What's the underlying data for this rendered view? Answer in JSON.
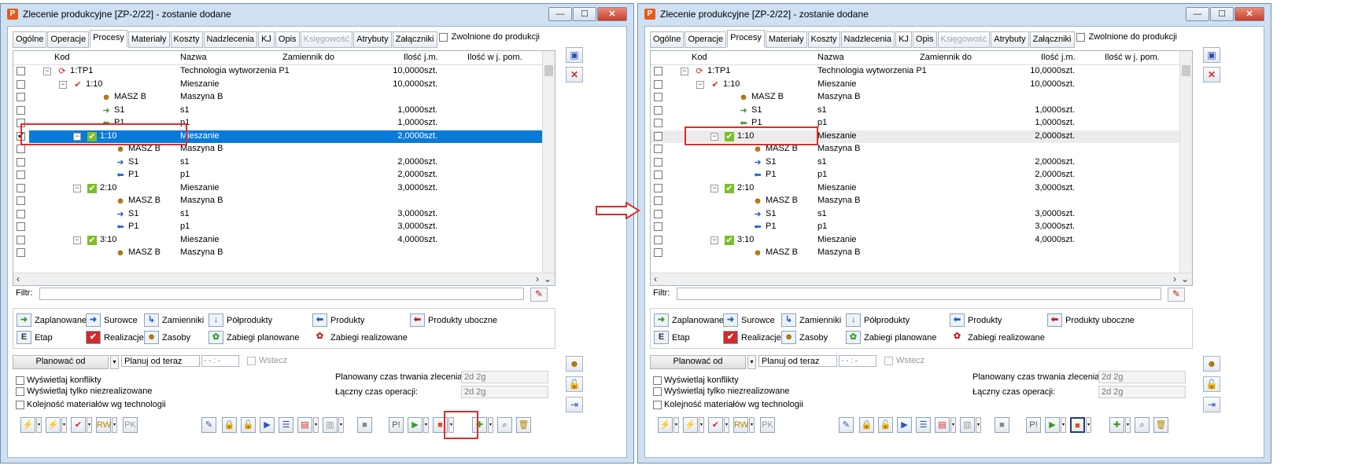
{
  "window": {
    "title": "Zlecenie produkcyjne  [ZP-2/22] - zostanie dodane",
    "app_icon": "P"
  },
  "tabs": [
    "Ogólne",
    "Operacje",
    "Procesy",
    "Materiały",
    "Koszty",
    "Nadzlecenia",
    "KJ",
    "Opis",
    "Księgowość",
    "Atrybuty",
    "Załączniki"
  ],
  "active_tab": "Procesy",
  "release_label": "Zwolnione do produkcji",
  "columns": {
    "kod": "Kod",
    "nazwa": "Nazwa",
    "zamiennik": "Zamiennik do",
    "ilosc": "Ilość",
    "jm": "j.m.",
    "ilosc_pom": "Ilość w j. pom."
  },
  "rows": [
    {
      "kod": "1:TP1",
      "nazwa": "Technologia wytworzenia P1",
      "ilosc": "10,0000",
      "jm": "szt.",
      "icon": "refresh-icon"
    },
    {
      "kod": "1:10",
      "nazwa": "Mieszanie",
      "ilosc": "10,0000",
      "jm": "szt.",
      "icon": "check-red-icon"
    },
    {
      "kod": "MASZ B",
      "nazwa": "Maszyna B",
      "ilosc": "",
      "jm": "",
      "icon": "worker-icon"
    },
    {
      "kod": "S1",
      "nazwa": "s1",
      "ilosc": "1,0000",
      "jm": "szt.",
      "icon": "arrow-right-green-icon"
    },
    {
      "kod": "P1",
      "nazwa": "p1",
      "ilosc": "1,0000",
      "jm": "szt.",
      "icon": "arrow-left-green-icon"
    },
    {
      "kod": "1:10",
      "nazwa": "Mieszanie",
      "ilosc": "2,0000",
      "jm": "szt.",
      "icon": "check-green-icon"
    },
    {
      "kod": "MASZ B",
      "nazwa": "Maszyna B",
      "ilosc": "",
      "jm": "",
      "icon": "worker-icon"
    },
    {
      "kod": "S1",
      "nazwa": "s1",
      "ilosc": "2,0000",
      "jm": "szt.",
      "icon": "arrow-right-blue-icon"
    },
    {
      "kod": "P1",
      "nazwa": "p1",
      "ilosc": "2,0000",
      "jm": "szt.",
      "icon": "arrow-left-blue-icon"
    },
    {
      "kod": "2:10",
      "nazwa": "Mieszanie",
      "ilosc": "3,0000",
      "jm": "szt.",
      "icon": "check-green-icon"
    },
    {
      "kod": "MASZ B",
      "nazwa": "Maszyna B",
      "ilosc": "",
      "jm": "",
      "icon": "worker-icon"
    },
    {
      "kod": "S1",
      "nazwa": "s1",
      "ilosc": "3,0000",
      "jm": "szt.",
      "icon": "arrow-right-blue-icon"
    },
    {
      "kod": "P1",
      "nazwa": "p1",
      "ilosc": "3,0000",
      "jm": "szt.",
      "icon": "arrow-left-blue-icon"
    },
    {
      "kod": "3:10",
      "nazwa": "Mieszanie",
      "ilosc": "4,0000",
      "jm": "szt.",
      "icon": "check-green-icon"
    },
    {
      "kod": "MASZ B",
      "nazwa": "Maszyna B",
      "ilosc": "",
      "jm": "",
      "icon": "worker-icon"
    }
  ],
  "filter_label": "Filtr:",
  "legend": {
    "zaplanowane": "Zaplanowane",
    "surowce": "Surowce",
    "zamienniki": "Zamienniki",
    "polprodukty": "Półprodukty",
    "produkty": "Produkty",
    "produkty_uboczne": "Produkty uboczne",
    "etap": "Etap",
    "realizacje": "Realizacje",
    "zasoby": "Zasoby",
    "zabiegi_planowane": "Zabiegi planowane",
    "zabiegi_realizowane": "Zabiegi realizowane",
    "etap_icon_letter": "E"
  },
  "planning": {
    "button": "Planować od",
    "mode": "Planuj od teraz",
    "time": "- - : -",
    "wstecz": "Wstecz",
    "planned_label": "Planowany czas trwania zlecenia:",
    "planned_value": "2d 2g",
    "total_label": "Łączny czas operacji:",
    "total_value": "2d 2g"
  },
  "options": [
    "Wyświetlaj konflikty",
    "Wyświetlaj tylko niezrealizowane",
    "Kolejność materiałów wg technologii"
  ],
  "colors": {
    "accent": "#0a7ad9",
    "highlight": "#e12b2b",
    "window_bg": "#cfe0f3"
  }
}
